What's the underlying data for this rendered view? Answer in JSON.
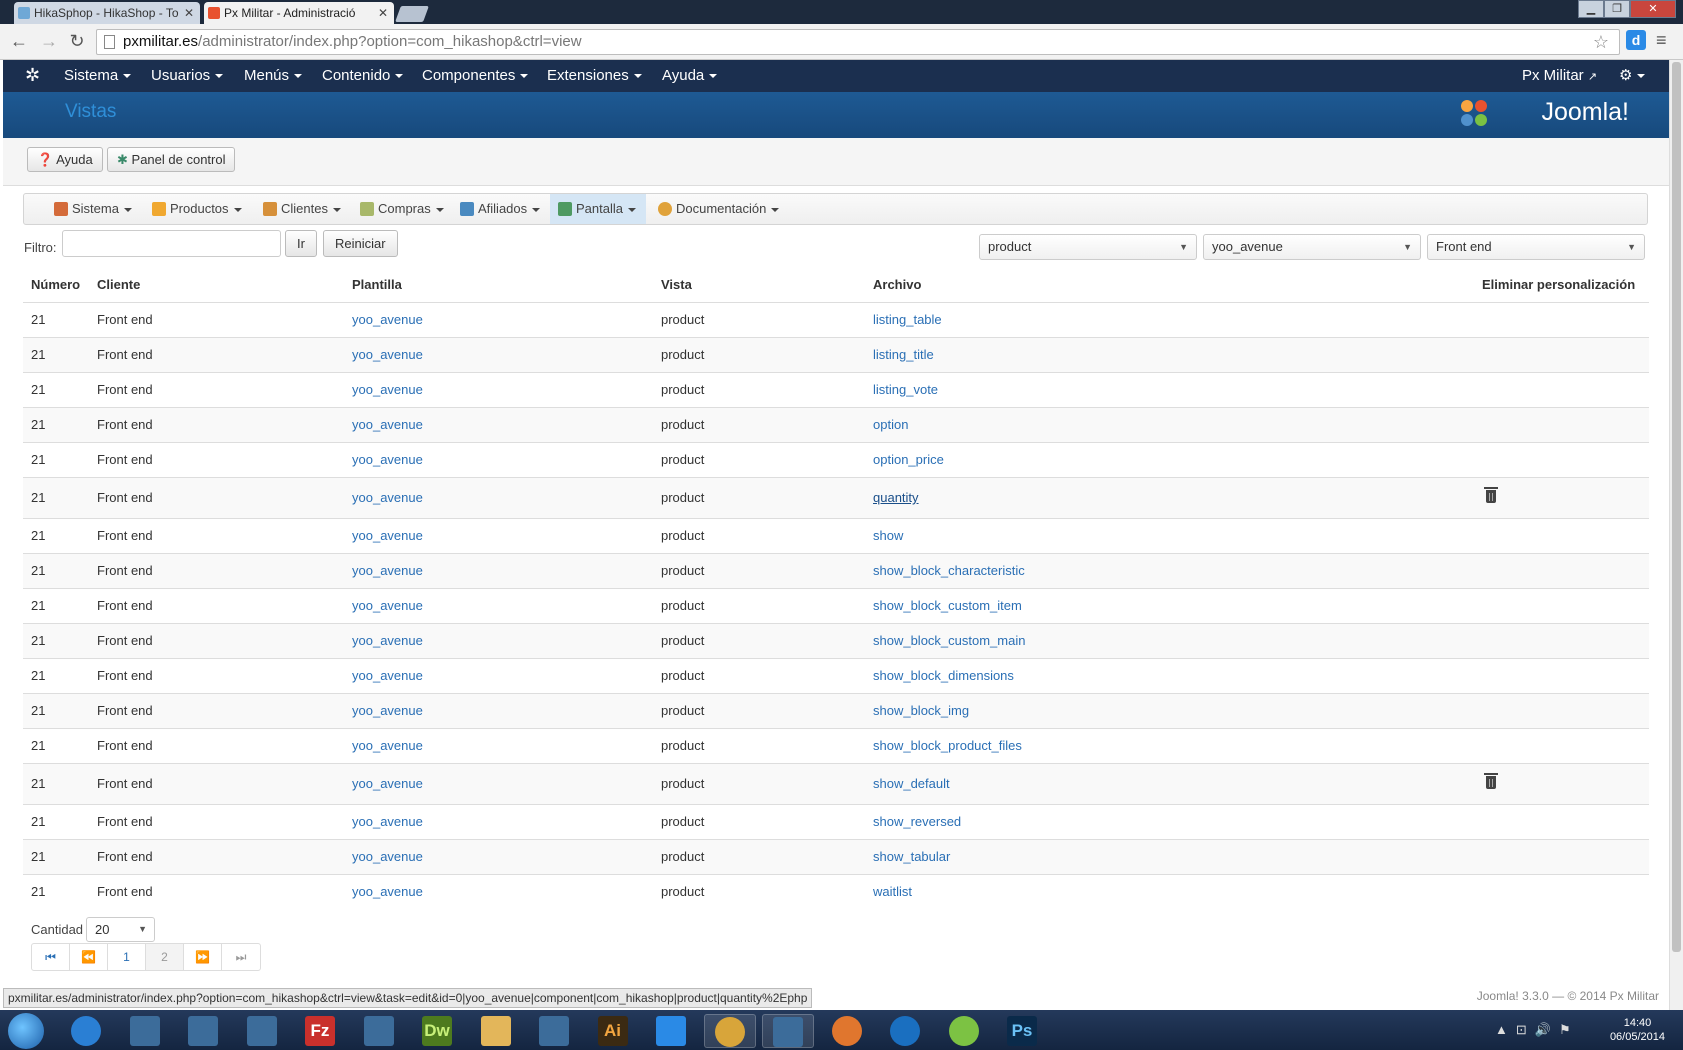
{
  "browser": {
    "tabs": [
      {
        "label": "HikaSphop - HikaShop - To",
        "active": false
      },
      {
        "label": "Px Militar - Administració",
        "active": true
      }
    ],
    "url_host": "pxmilitar.es",
    "url_path": "/administrator/index.php?option=com_hikashop&ctrl=view"
  },
  "joomla_nav": {
    "items": [
      "Sistema",
      "Usuarios",
      "Menús",
      "Contenido",
      "Componentes",
      "Extensiones",
      "Ayuda"
    ],
    "site_link": "Px Militar"
  },
  "header": {
    "page_title": "Vistas",
    "brand": "Joomla!"
  },
  "toolbar": {
    "help_label": "Ayuda",
    "control_panel_label": "Panel de control"
  },
  "submenu": {
    "items": [
      "Sistema",
      "Productos",
      "Clientes",
      "Compras",
      "Afiliados",
      "Pantalla",
      "Documentación"
    ],
    "active": "Pantalla"
  },
  "filter": {
    "label": "Filtro:",
    "value": "",
    "go_label": "Ir",
    "reset_label": "Reiniciar",
    "view_select": "product",
    "template_select": "yoo_avenue",
    "client_select": "Front end"
  },
  "table": {
    "headers": [
      "Número",
      "Cliente",
      "Plantilla",
      "Vista",
      "Archivo",
      "Eliminar personalización"
    ],
    "rows": [
      {
        "num": "21",
        "client": "Front end",
        "template": "yoo_avenue",
        "view": "product",
        "file": "listing_table",
        "custom": false
      },
      {
        "num": "21",
        "client": "Front end",
        "template": "yoo_avenue",
        "view": "product",
        "file": "listing_title",
        "custom": false
      },
      {
        "num": "21",
        "client": "Front end",
        "template": "yoo_avenue",
        "view": "product",
        "file": "listing_vote",
        "custom": false
      },
      {
        "num": "21",
        "client": "Front end",
        "template": "yoo_avenue",
        "view": "product",
        "file": "option",
        "custom": false
      },
      {
        "num": "21",
        "client": "Front end",
        "template": "yoo_avenue",
        "view": "product",
        "file": "option_price",
        "custom": false
      },
      {
        "num": "21",
        "client": "Front end",
        "template": "yoo_avenue",
        "view": "product",
        "file": "quantity",
        "custom": true
      },
      {
        "num": "21",
        "client": "Front end",
        "template": "yoo_avenue",
        "view": "product",
        "file": "show",
        "custom": false
      },
      {
        "num": "21",
        "client": "Front end",
        "template": "yoo_avenue",
        "view": "product",
        "file": "show_block_characteristic",
        "custom": false
      },
      {
        "num": "21",
        "client": "Front end",
        "template": "yoo_avenue",
        "view": "product",
        "file": "show_block_custom_item",
        "custom": false
      },
      {
        "num": "21",
        "client": "Front end",
        "template": "yoo_avenue",
        "view": "product",
        "file": "show_block_custom_main",
        "custom": false
      },
      {
        "num": "21",
        "client": "Front end",
        "template": "yoo_avenue",
        "view": "product",
        "file": "show_block_dimensions",
        "custom": false
      },
      {
        "num": "21",
        "client": "Front end",
        "template": "yoo_avenue",
        "view": "product",
        "file": "show_block_img",
        "custom": false
      },
      {
        "num": "21",
        "client": "Front end",
        "template": "yoo_avenue",
        "view": "product",
        "file": "show_block_product_files",
        "custom": false
      },
      {
        "num": "21",
        "client": "Front end",
        "template": "yoo_avenue",
        "view": "product",
        "file": "show_default",
        "custom": true
      },
      {
        "num": "21",
        "client": "Front end",
        "template": "yoo_avenue",
        "view": "product",
        "file": "show_reversed",
        "custom": false
      },
      {
        "num": "21",
        "client": "Front end",
        "template": "yoo_avenue",
        "view": "product",
        "file": "show_tabular",
        "custom": false
      },
      {
        "num": "21",
        "client": "Front end",
        "template": "yoo_avenue",
        "view": "product",
        "file": "waitlist",
        "custom": false
      }
    ]
  },
  "pagination": {
    "quantity_label": "Cantidad",
    "quantity_value": "20",
    "pages": [
      "1",
      "2"
    ],
    "current": "1"
  },
  "status_url": "pxmilitar.es/administrator/index.php?option=com_hikashop&ctrl=view&task=edit&id=0|yoo_avenue|component|com_hikashop|product|quantity%2Ephp",
  "footer": "Joomla! 3.3.0 — © 2014 Px Militar",
  "taskbar": {
    "time": "14:40",
    "date": "06/05/2014",
    "apps": [
      "internet-explorer",
      "app",
      "app",
      "app",
      "filezilla",
      "app",
      "dreamweaver",
      "folder",
      "app",
      "illustrator",
      "dropbox",
      "chrome",
      "app",
      "firefox",
      "teamviewer",
      "spotify",
      "photoshop"
    ],
    "app_labels": {
      "filezilla": "Fz",
      "dreamweaver": "Dw",
      "illustrator": "Ai",
      "photoshop": "Ps"
    }
  },
  "colors": {
    "nav_bg": "#1b2f4f",
    "header_bg": "#1e5a94",
    "link": "#2a6fb5",
    "active_submenu": "#d5e6f5"
  }
}
